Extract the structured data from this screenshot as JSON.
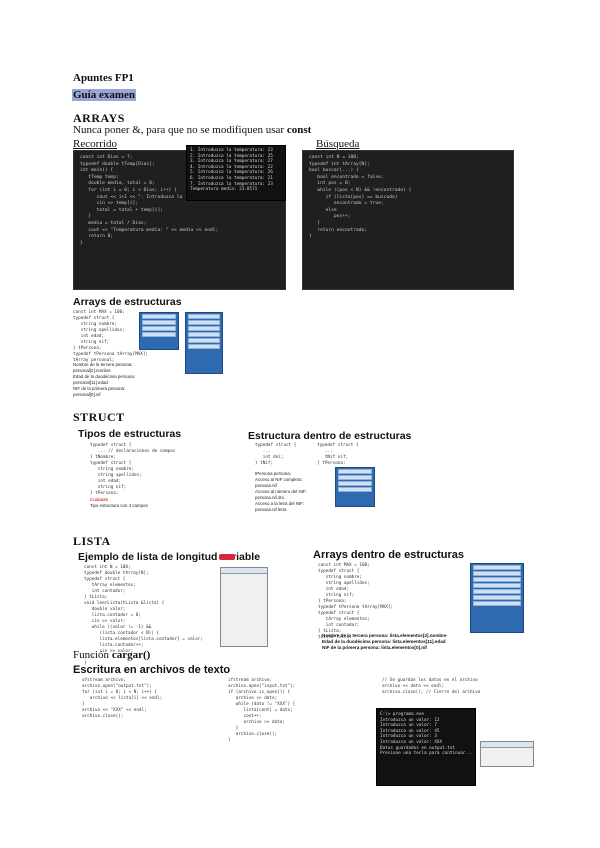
{
  "header": {
    "title": "Apuntes FP1",
    "subtitle": "Guía examen"
  },
  "arrays": {
    "heading": "ARRAYS",
    "note_prefix": "Nunca poner &, para que no se modifiquen usar ",
    "note_keyword": "const",
    "recorrido_label": "Recorrido",
    "busqueda_label": "Búsqueda",
    "structs_figure_title": "Arrays de estructuras",
    "output_lines": [
      "1. Introduzca la temperatura: 23",
      "2. Introduzca la temperatura: 25",
      "3. Introduzca la temperatura: 27",
      "4. Introduzca la temperatura: 22",
      "5. Introduzca la temperatura: 26",
      "6. Introduzca la temperatura: 21",
      "7. Introduzca la temperatura: 23",
      "Temperatura media: 23.8571"
    ],
    "recorrido_code": [
      "const int Dias = 7;",
      "typedef double tTemp[Dias];",
      "",
      "int main() {",
      "   tTemp temp;",
      "   double media, total = 0;",
      "",
      "   for (int i = 0; i < Dias; i++) {",
      "      cout << i+1 << \". Introduzca la temperatura: \";",
      "      cin >> temp[i];",
      "",
      "      total = total + temp[i];",
      "   }",
      "",
      "   media = total / Dias;",
      "",
      "   cout << \"Temperatura media: \" << media << endl;",
      "",
      "   return 0;",
      "}"
    ],
    "busqueda_code": [
      "const int N = 100;",
      "typedef int tArray[N];",
      "",
      "bool buscar(...) {",
      "   bool encontrado = false;",
      "   int pos = 0;",
      "",
      "   while ((pos < N) && !encontrado) {",
      "      if (lista[pos] == buscado)",
      "         encontrado = true;",
      "      else",
      "         pos++;",
      "   }",
      "",
      "   return encontrado;",
      "}"
    ],
    "structs_code": [
      "const int MAX = 100;",
      "typedef struct {",
      "   string nombre;",
      "   string apellidos;",
      "   int edad;",
      "   string nif;",
      "} tPersona;",
      "typedef tPersona tArray[MAX];",
      "tArray personal;"
    ],
    "structs_notes": [
      "Nombre de la tercera persona:",
      "personal[2].nombre",
      "Edad de la duodécima persona:",
      "personal[11].edad",
      "NIF de la primera persona:",
      "personal[0].nif"
    ]
  },
  "struct_section": {
    "heading": "STRUCT",
    "tipos_title": "Tipos de estructuras",
    "anidada_title": "Estructura dentro de estructuras",
    "tipos_code": [
      "typedef struct {",
      "   ... // declaraciones de campos",
      "} tNombre;",
      "",
      "typedef struct {",
      "   string nombre;",
      "   string apellidos;",
      "   int edad;",
      "   string nif;",
      "} tPersona;"
    ],
    "tipos_warning": "Cuidado!",
    "tipos_footer": "Tipo estructura con 4 campos",
    "anidada_code": [
      "typedef struct {        typedef struct {",
      "   ...                     ...",
      "   int dni;                tNif nif;",
      "} tNif;                 } tPersona;"
    ],
    "anidada_notes": [
      "tPersona persona;",
      "Acceso al NIF completo:",
      "persona.nif",
      "Acceso al número del NIF:",
      "persona.nif.dni",
      "Acceso a la letra del NIF:",
      "persona.nif.letra"
    ]
  },
  "lista_section": {
    "heading": "LISTA",
    "variable_title": "Ejemplo de lista de longitud variable",
    "arrays_title": "Arrays dentro de estructuras",
    "variable_code": [
      "const int N = 100;",
      "typedef double tArray[N];",
      "typedef struct {",
      "   tArray elementos;",
      "   int contador;",
      "} tLista;",
      "",
      "void leerLista(tLista &lista) {",
      "   double valor;",
      "   lista.contador = 0;",
      "   cin >> valor;",
      "   while ((valor != -1) &&",
      "      (lista.contador < N)) {",
      "      lista.elementos[lista.contador] = valor;",
      "      lista.contador++;",
      "      cin >> valor;",
      "   }",
      "}"
    ],
    "arrays_code": [
      "const int MAX = 100;",
      "typedef struct {",
      "   string nombre;",
      "   string apellidos;",
      "   int edad;",
      "   string nif;",
      "} tPersona;",
      "typedef tPersona tArray[MAX];",
      "typedef struct {",
      "   tArray elementos;",
      "   int contador;",
      "} tLista;",
      "tLista lista;"
    ],
    "arrays_notes": [
      "Nombre de la tercera persona: lista.elementos[2].nombre",
      "Edad de la duodécima persona: lista.elementos[11].edad",
      "NIF de la primera persona: lista.elementos[0].nif"
    ]
  },
  "cargar_section": {
    "heading_prefix": "Función ",
    "heading_keyword": "cargar()",
    "figure_title": "Escritura en archivos de texto",
    "code_left": [
      "ofstream archivo;",
      "archivo.open(\"output.txt\");",
      "",
      "for (int i = 0; i < N; i++) {",
      "   archivo << lista[i] << endl;",
      "}",
      "",
      "archivo << \"XXX\" << endl;",
      "archivo.close();"
    ],
    "code_middle": [
      "ifstream archivo;",
      "archivo.open(\"input.txt\");",
      "if (archivo.is_open()) {",
      "   archivo >> dato;",
      "   while (dato != \"XXX\") {",
      "      lista[cont] = dato;",
      "      cont++;",
      "      archivo >> dato;",
      "   }",
      "   archivo.close();",
      "}"
    ],
    "code_right": [
      "// Se guardan los datos en el archivo",
      "archivo << dato << endl;",
      "archivo.close(); // Cierre del archivo"
    ],
    "console_lines": [
      "C:\\> programa.exe",
      "Introduzca un valor: 12",
      "Introduzca un valor: 7",
      "Introduzca un valor: 45",
      "Introduzca un valor: 3",
      "Introduzca un valor: XXX",
      "Datos guardados en output.txt",
      "Presione una tecla para continuar..."
    ]
  },
  "colors": {
    "subtitle_highlight": "#9aa6d6",
    "code_background": "#1f1f1f",
    "memory_box": "#2e6ab0",
    "accent_red": "#d6283a"
  }
}
